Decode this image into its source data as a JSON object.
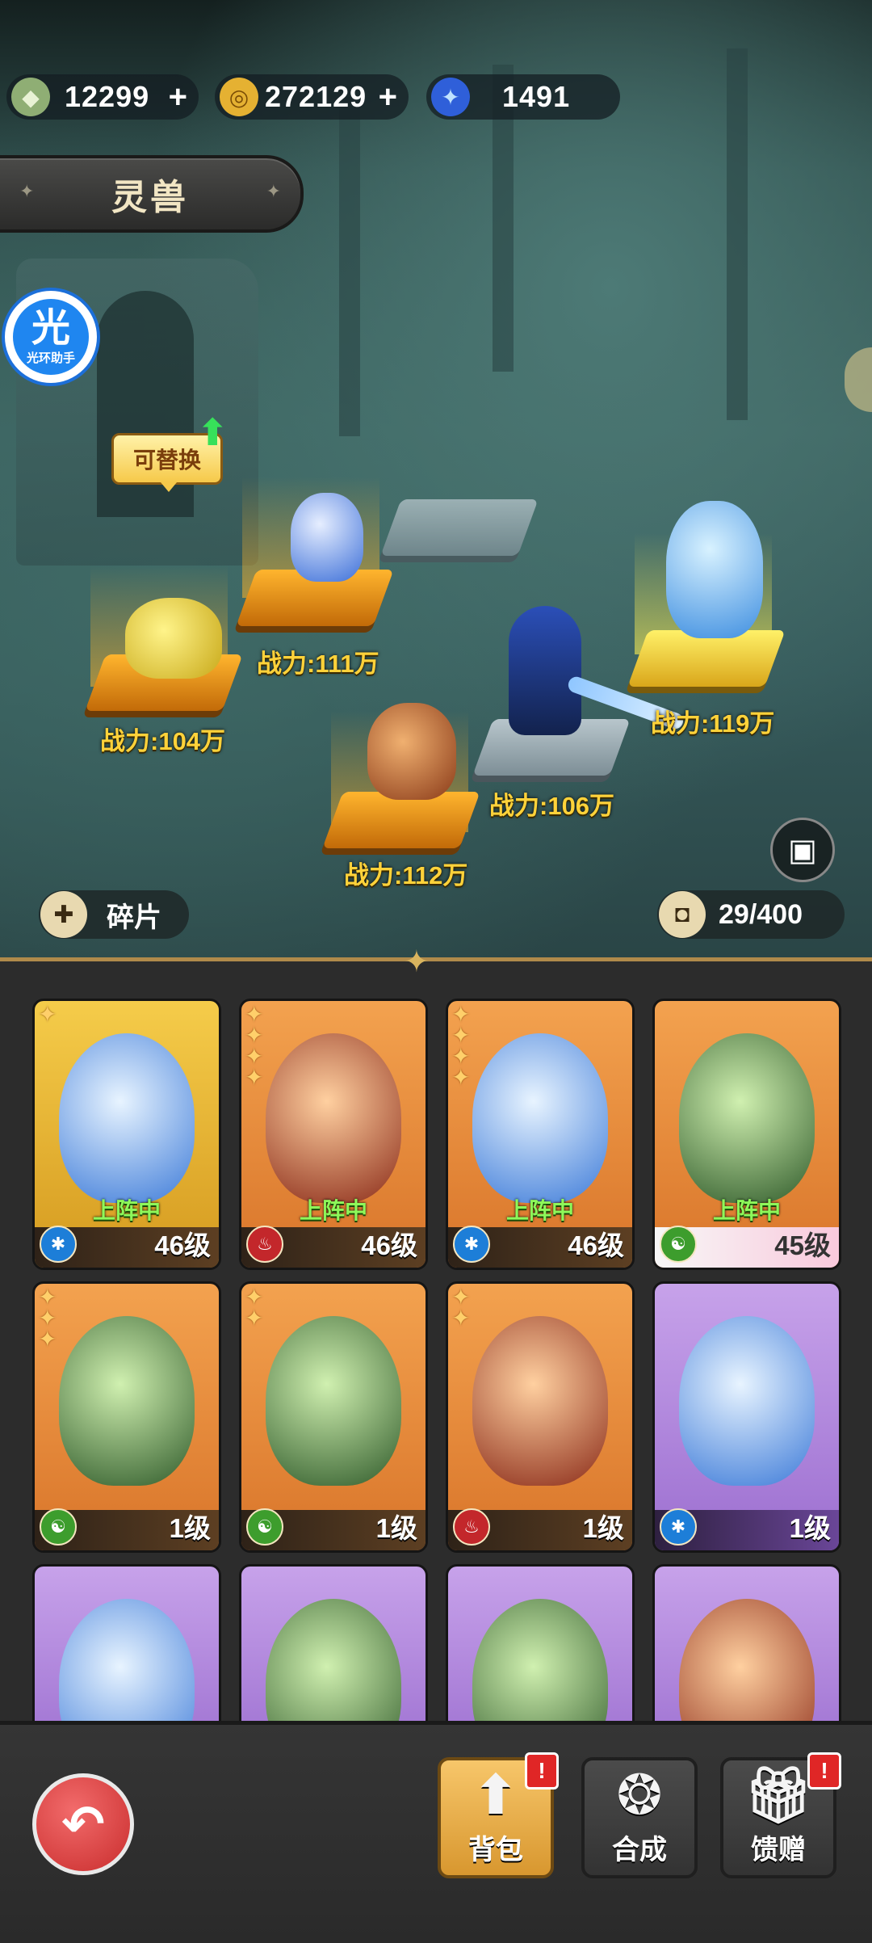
{
  "currencies": [
    {
      "icon": "jade-pouch-icon",
      "value": "12299",
      "plus": "+"
    },
    {
      "icon": "gold-coin-icon",
      "value": "272129",
      "plus": "+"
    },
    {
      "icon": "blue-crystal-icon",
      "value": "1491"
    }
  ],
  "title": "灵兽",
  "helper": {
    "big": "光",
    "small": "光环助手"
  },
  "replace_tag": "可替换",
  "formation": [
    {
      "power": "战力:104万"
    },
    {
      "power": "战力:111万"
    },
    {
      "power": "战力:112万"
    },
    {
      "power": "战力:106万"
    },
    {
      "power": "战力:119万"
    }
  ],
  "fragments_label": "碎片",
  "capacity": "29/400",
  "deployed_label": "上阵中",
  "cards": [
    {
      "rarity": "gold",
      "stars": 1,
      "element": "water",
      "level": "46级",
      "deployed": true
    },
    {
      "rarity": "orange",
      "stars": 4,
      "element": "fire",
      "level": "46级",
      "deployed": true
    },
    {
      "rarity": "orange",
      "stars": 4,
      "element": "water",
      "level": "46级",
      "deployed": true
    },
    {
      "rarity": "orange",
      "stars": 0,
      "element": "wind",
      "level": "45级",
      "deployed": true
    },
    {
      "rarity": "orange",
      "stars": 3,
      "element": "wind",
      "level": "1级",
      "deployed": false
    },
    {
      "rarity": "orange",
      "stars": 2,
      "element": "wind",
      "level": "1级",
      "deployed": false
    },
    {
      "rarity": "orange",
      "stars": 2,
      "element": "fire",
      "level": "1级",
      "deployed": false
    },
    {
      "rarity": "purple",
      "stars": 0,
      "element": "water",
      "level": "1级",
      "deployed": false
    },
    {
      "rarity": "purple",
      "stars": 0,
      "element": "water",
      "level": "",
      "deployed": false
    },
    {
      "rarity": "purple",
      "stars": 0,
      "element": "wind",
      "level": "",
      "deployed": false
    },
    {
      "rarity": "purple",
      "stars": 0,
      "element": "wind",
      "level": "",
      "deployed": false
    },
    {
      "rarity": "purple",
      "stars": 0,
      "element": "fire",
      "level": "",
      "deployed": false
    }
  ],
  "nav": {
    "bag": "背包",
    "synthesize": "合成",
    "gift": "馈赠",
    "alert": "!"
  },
  "colors": {
    "accent_gold": "#d59a1f",
    "deployed_green": "#8ef85a",
    "power_yellow": "#ffd23a"
  }
}
